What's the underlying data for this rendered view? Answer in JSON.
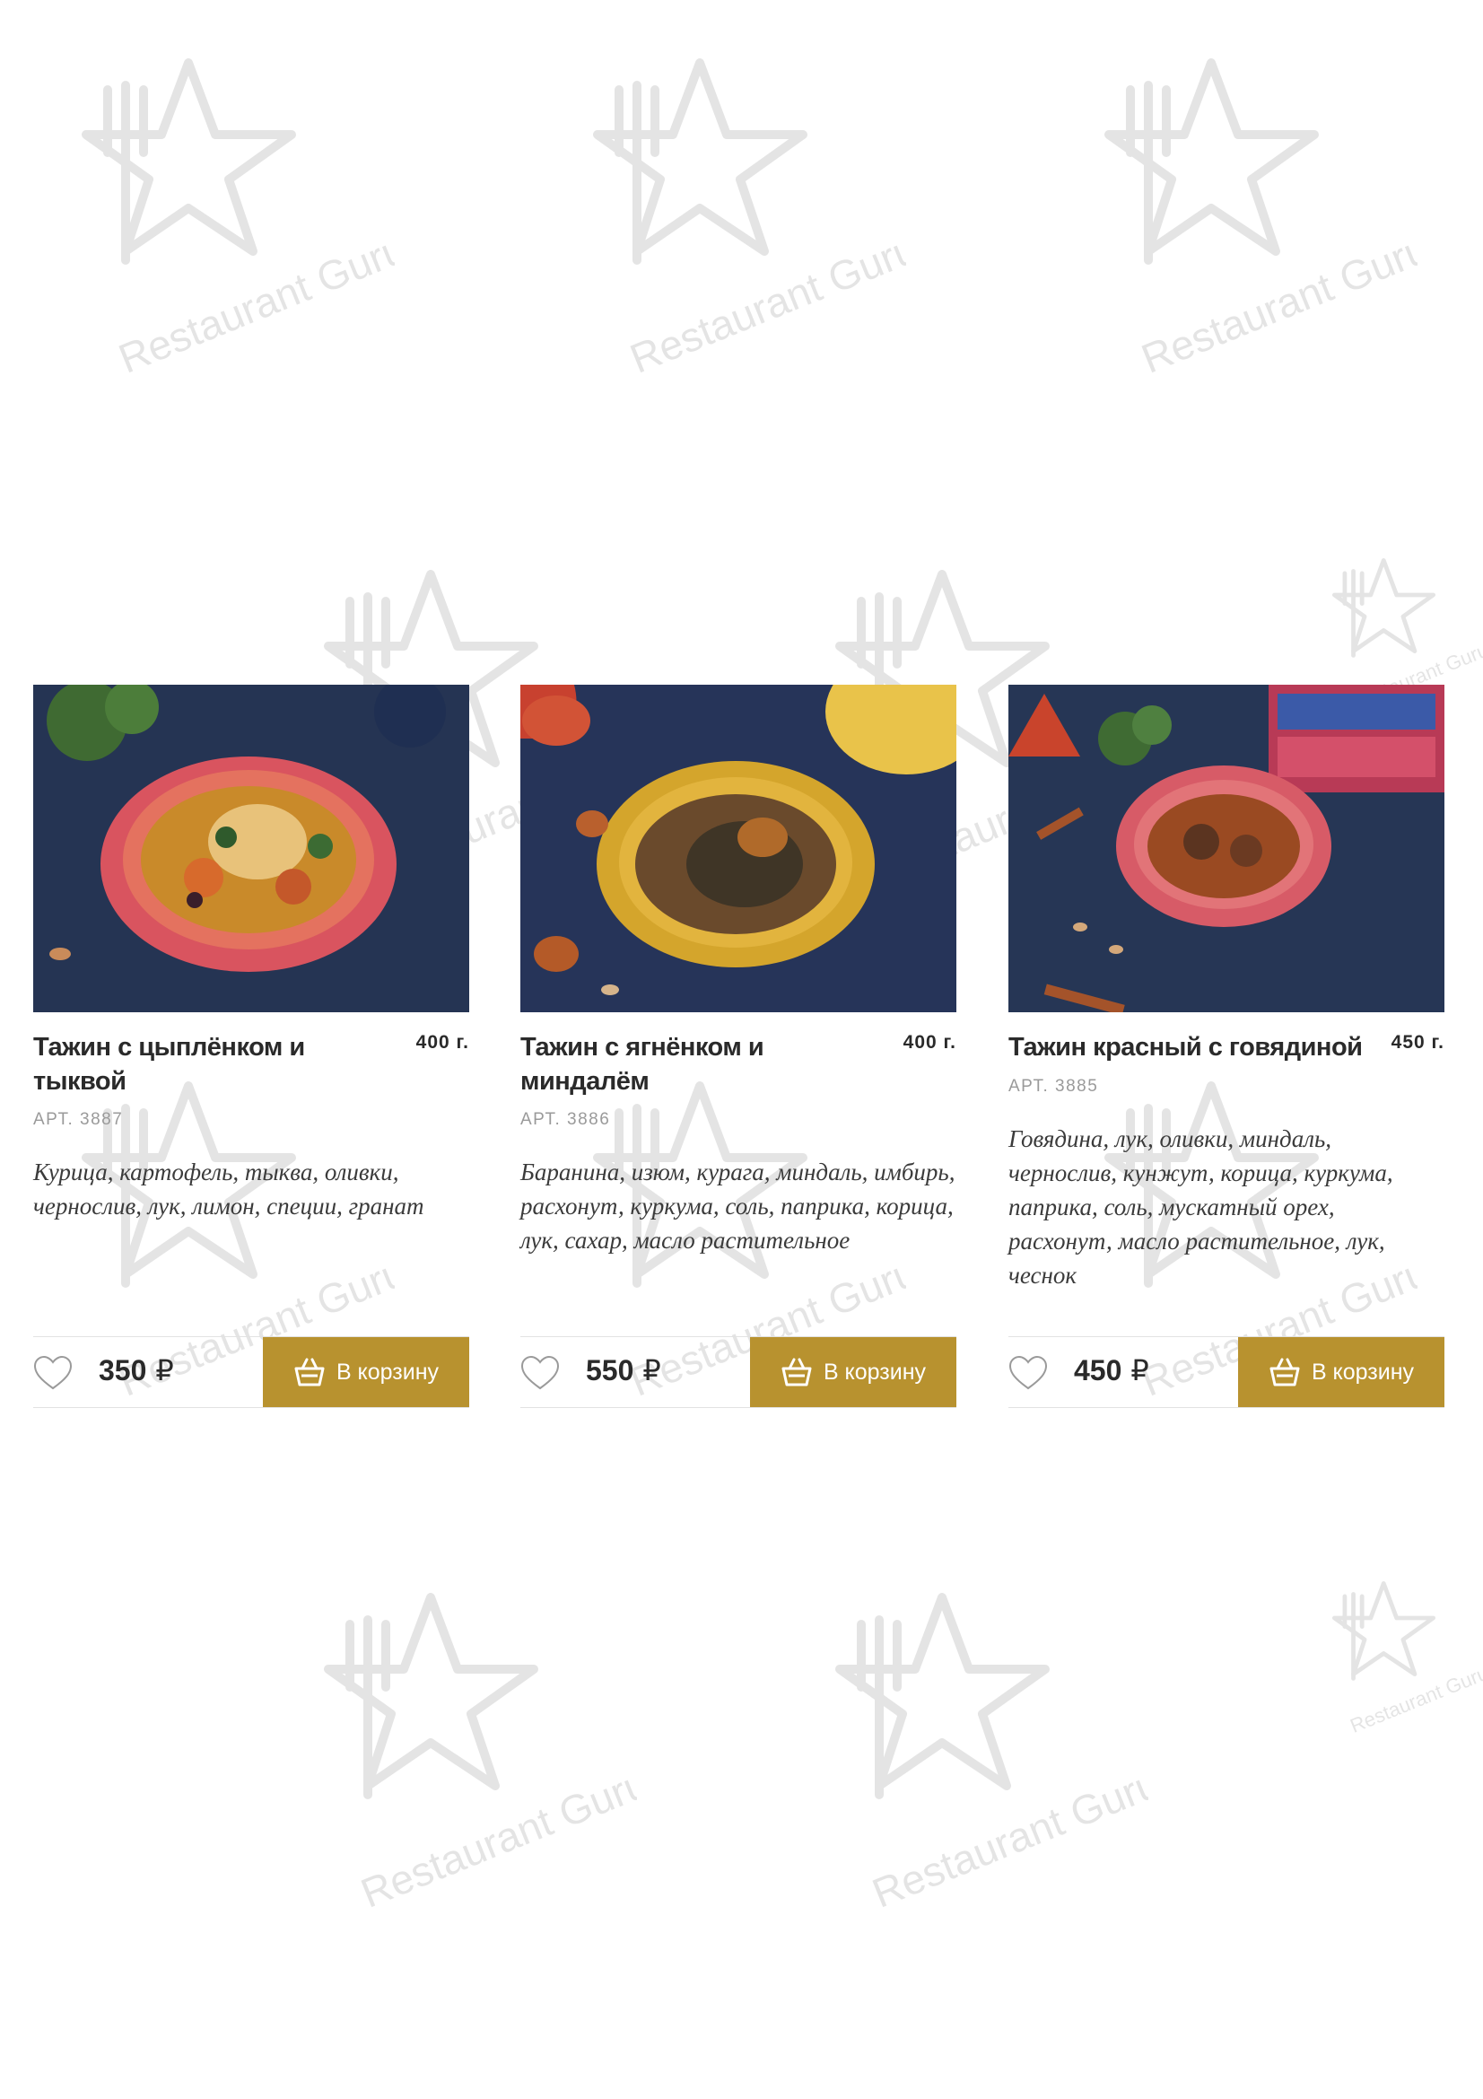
{
  "watermark": {
    "text": "Restaurant Guru"
  },
  "products": [
    {
      "title": "Тажин с цыплёнком и тыквой",
      "weight": "400 г.",
      "article": "АРТ. 3887",
      "description": "Курица, картофель, тыква, оливки, чернослив, лук, лимон, специи, гранат",
      "price": "350",
      "currency": "₽",
      "cart_label": "В корзину"
    },
    {
      "title": "Тажин с ягнёнком и миндалём",
      "weight": "400 г.",
      "article": "АРТ. 3886",
      "description": "Баранина, изюм, курага, миндаль, имбирь, расхонут, куркума, соль, паприка, корица, лук, сахар, масло растительное",
      "price": "550",
      "currency": "₽",
      "cart_label": "В корзину"
    },
    {
      "title": "Тажин красный с говядиной",
      "weight": "450 г.",
      "article": "АРТ. 3885",
      "description": "Говядина, лук, оливки, миндаль, чернослив, кунжут, корица, куркума, паприка, соль, мускатный орех, расхонут, масло растительное, лук, чеснок",
      "price": "450",
      "currency": "₽",
      "cart_label": "В корзину"
    }
  ],
  "colors": {
    "accent": "#b8922f",
    "text": "#2a2a2a",
    "muted": "#9a9a9a",
    "photo_bg": "#27385c"
  }
}
